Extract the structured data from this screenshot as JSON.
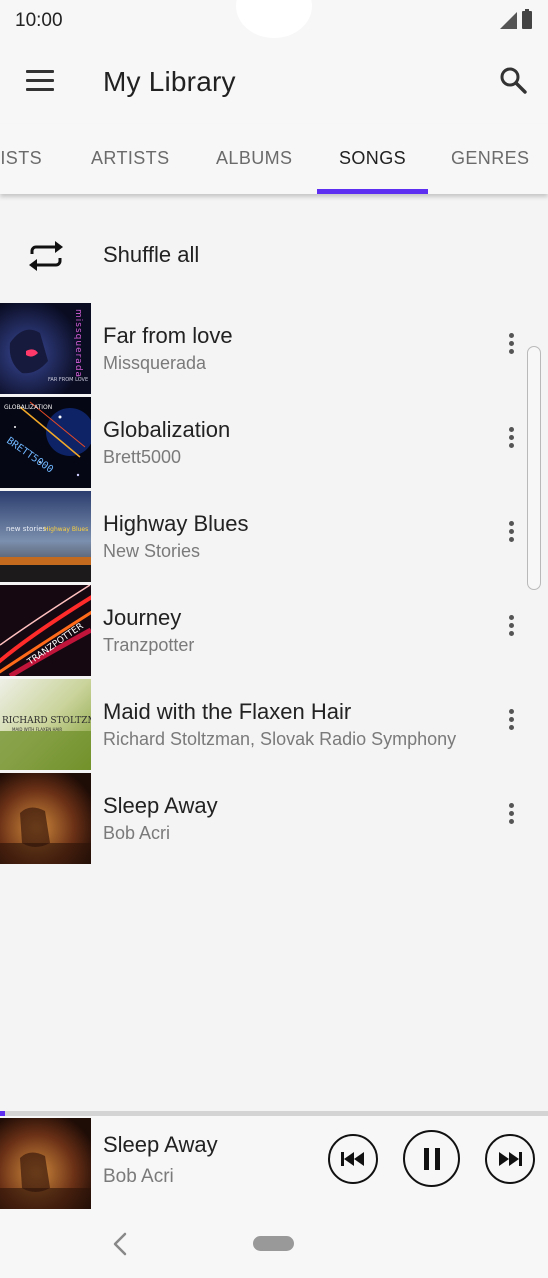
{
  "status_bar": {
    "time": "10:00"
  },
  "app_bar": {
    "title": "My Library",
    "menu_icon": "hamburger-icon",
    "search_icon": "search-icon"
  },
  "tabs": [
    {
      "label": "LISTS",
      "active": false
    },
    {
      "label": "ARTISTS",
      "active": false
    },
    {
      "label": "ALBUMS",
      "active": false
    },
    {
      "label": "SONGS",
      "active": true
    },
    {
      "label": "GENRES",
      "active": false
    }
  ],
  "shuffle": {
    "label": "Shuffle all",
    "icon": "shuffle-repeat-icon"
  },
  "songs": [
    {
      "title": "Far from love",
      "artist": "Missquerada"
    },
    {
      "title": "Globalization",
      "artist": "Brett5000"
    },
    {
      "title": "Highway Blues",
      "artist": "New Stories"
    },
    {
      "title": "Journey",
      "artist": "Tranzpotter"
    },
    {
      "title": "Maid with the Flaxen Hair",
      "artist": "Richard Stoltzman, Slovak Radio Symphony"
    },
    {
      "title": "Sleep Away",
      "artist": "Bob Acri"
    }
  ],
  "cover_art_text": {
    "far_from_love": [
      "missquerada",
      "FAR FROM LOVE"
    ],
    "globalization": [
      "GLOBALIZATION",
      "BRETT5000"
    ],
    "highway_blues": [
      "new stories",
      "Highway Blues"
    ],
    "journey": [
      "TRANZPOTTER"
    ],
    "maid_with_the_flaxen_hair": [
      "RICHARD STOLTZMAN",
      "MAID WITH FLAXEN HAIR"
    ]
  },
  "now_playing": {
    "title": "Sleep Away",
    "artist": "Bob Acri",
    "progress": 0.01,
    "controls": [
      "skip-previous-icon",
      "pause-icon",
      "skip-next-icon"
    ]
  },
  "colors": {
    "accent": "#5e2ff0",
    "background": "#f7f7f7",
    "text_primary": "#212121",
    "text_secondary": "#7a7a7a"
  }
}
